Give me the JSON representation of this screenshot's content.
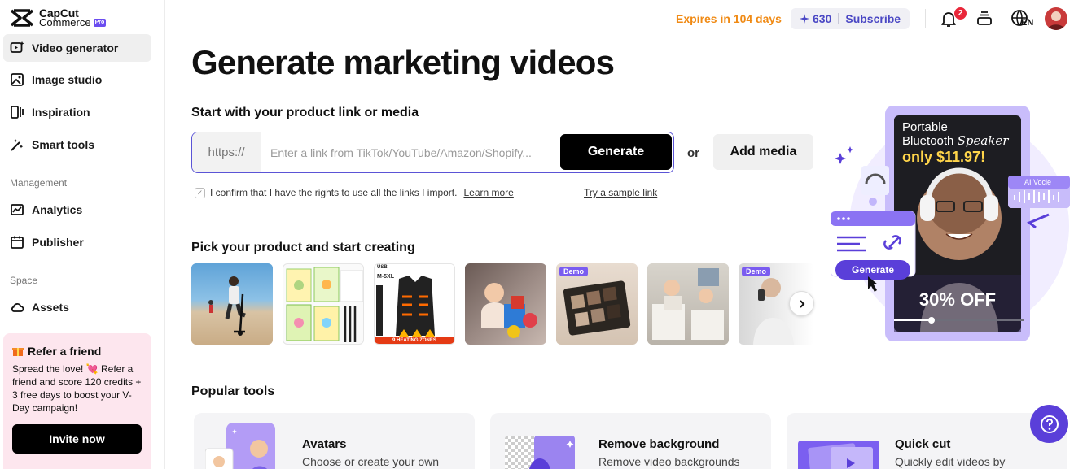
{
  "brand": {
    "line1": "CapCut",
    "line2": "Commerce",
    "badge": "Pro"
  },
  "sidebar": {
    "items": [
      {
        "label": "Video generator",
        "icon": "video-generator-icon",
        "active": true
      },
      {
        "label": "Image studio",
        "icon": "image-studio-icon"
      },
      {
        "label": "Inspiration",
        "icon": "inspiration-icon"
      },
      {
        "label": "Smart tools",
        "icon": "magic-wand-icon"
      }
    ],
    "management_label": "Management",
    "management_items": [
      {
        "label": "Analytics",
        "icon": "analytics-icon"
      },
      {
        "label": "Publisher",
        "icon": "calendar-icon"
      }
    ],
    "space_label": "Space",
    "space_items": [
      {
        "label": "Assets",
        "icon": "cloud-icon"
      }
    ],
    "refer": {
      "title": "Refer a friend",
      "body": "Spread the love! 💘 Refer a friend and score 120 credits + 3 free days to boost your V-Day campaign!",
      "button": "Invite now"
    }
  },
  "topbar": {
    "expires": "Expires in 104 days",
    "credits": "630",
    "subscribe": "Subscribe",
    "notification_count": "2",
    "language": "EN"
  },
  "main": {
    "title": "Generate marketing videos",
    "link_section": "Start with your product link or media",
    "https_prefix": "https://",
    "link_placeholder": "Enter a link from TikTok/YouTube/Amazon/Shopify...",
    "generate": "Generate",
    "or": "or",
    "add_media": "Add media",
    "confirm_text": "I confirm that I have the rights to use all the links I import.",
    "learn_more": "Learn more",
    "sample_link": "Try a sample link",
    "products_heading": "Pick your product and start creating",
    "products": [
      {
        "name": "beach-scooter"
      },
      {
        "name": "kids-workbooks"
      },
      {
        "name": "heated-vest",
        "tag_top": "USB",
        "size": "M-5XL",
        "tag_bottom": "9 HEATING ZONES"
      },
      {
        "name": "baby-toy"
      },
      {
        "name": "eyeshadow-palette",
        "demo": "Demo"
      },
      {
        "name": "baby-highchair"
      },
      {
        "name": "phone-user",
        "demo": "Demo"
      }
    ],
    "popular_heading": "Popular tools",
    "tools": [
      {
        "title": "Avatars",
        "desc": "Choose or create your own"
      },
      {
        "title": "Remove background",
        "desc": "Remove video backgrounds"
      },
      {
        "title": "Quick cut",
        "desc": "Quickly edit videos by"
      }
    ]
  },
  "hero": {
    "line1": "Portable",
    "line2a": "Bluetooth ",
    "line2b": "Speaker",
    "line3": "only $11.97!",
    "ai_voice": "AI Vocie",
    "generate": "Generate",
    "discount": "30% OFF"
  },
  "colors": {
    "accent": "#5b54d6",
    "orange": "#f08a14",
    "refer_bg": "#fde6ee",
    "hero_bg": "#c9bdfb"
  }
}
